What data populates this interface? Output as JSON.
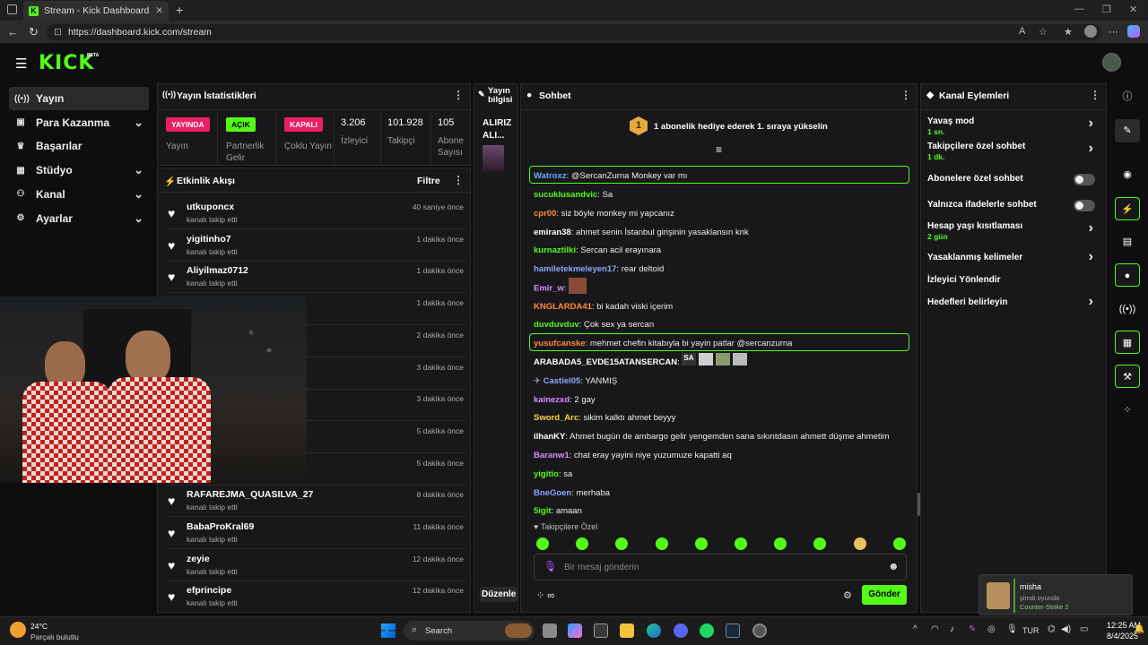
{
  "browser": {
    "tab_title": "Stream - Kick Dashboard",
    "url": "https://dashboard.kick.com/stream",
    "new_tab": "+",
    "close_tab": "✕"
  },
  "header": {
    "logo": "KICK",
    "beta": "BETA"
  },
  "sidebar": {
    "items": [
      {
        "label": "Yayın",
        "icon": "broadcast-icon",
        "expandable": false
      },
      {
        "label": "Para Kazanma",
        "icon": "money-icon",
        "expandable": true
      },
      {
        "label": "Başarılar",
        "icon": "trophy-icon",
        "expandable": false
      },
      {
        "label": "Stüdyo",
        "icon": "studio-icon",
        "expandable": true
      },
      {
        "label": "Kanal",
        "icon": "channel-icon",
        "expandable": true
      },
      {
        "label": "Ayarlar",
        "icon": "gear-icon",
        "expandable": true
      }
    ]
  },
  "stats": {
    "title": "Yayın İstatistikleri",
    "cols": [
      {
        "badge": "YAYINDA",
        "label": "Yayın",
        "color": "#e91e63"
      },
      {
        "badge": "AÇIK",
        "label": "Partnerlik Gelir",
        "color": "#53fc18"
      },
      {
        "badge": "KAPALI",
        "label": "Çoklu Yayın",
        "color": "#e91e63"
      },
      {
        "value": "3.206",
        "label": "İzleyici"
      },
      {
        "value": "101.928",
        "label": "Takipçi"
      },
      {
        "value": "105",
        "label": "Abone Sayısı"
      }
    ]
  },
  "activity": {
    "title": "Etkinlik Akışı",
    "filter": "Filtre",
    "events": [
      {
        "name": "utkuponcx",
        "sub": "kanalı takip etti",
        "time": "40 saniye önce"
      },
      {
        "name": "yigitinho7",
        "sub": "kanalı takip etti",
        "time": "1 dakika önce"
      },
      {
        "name": "Aliyilmaz0712",
        "sub": "kanalı takip etti",
        "time": "1 dakika önce"
      },
      {
        "name": "",
        "sub": "",
        "time": "1 dakika önce"
      },
      {
        "name": "",
        "sub": "",
        "time": "2 dakika önce"
      },
      {
        "name": "",
        "sub": "",
        "time": "3 dakika önce"
      },
      {
        "name": "",
        "sub": "",
        "time": "3 dakika önce"
      },
      {
        "name": "",
        "sub": "",
        "time": "5 dakika önce"
      },
      {
        "name": "",
        "sub": "",
        "time": "5 dakika önce"
      },
      {
        "name": "RAFAREJMA_QUASILVA_27",
        "sub": "kanalı takip etti",
        "time": "8 dakika önce"
      },
      {
        "name": "BabaProKral69",
        "sub": "kanalı takip etti",
        "time": "11 dakika önce"
      },
      {
        "name": "zeyie",
        "sub": "kanalı takip etti",
        "time": "12 dakika önce"
      },
      {
        "name": "efprincipe",
        "sub": "kanalı takip etti",
        "time": "12 dakika önce"
      }
    ]
  },
  "yayin_bilgisi": {
    "title": "Yayın bilgisi",
    "name": "ALIRIZ ALI...",
    "edit": "Düzenle"
  },
  "chat": {
    "title": "Sohbet",
    "promo_rank": "1",
    "promo": "1 abonelik hediye ederek 1. sıraya yükselin",
    "messages": [
      {
        "user": "Watroxz",
        "color": "#6aa9ff",
        "text": "@SercanZurna Monkey var mı",
        "highlight": true
      },
      {
        "user": "sucuklusandvic",
        "color": "#53fc18",
        "text": "Sa"
      },
      {
        "user": "cpr00",
        "color": "#ff8a3c",
        "text": "siz böyle monkey mi yapcanız"
      },
      {
        "user": "emiran38",
        "color": "#ffffff",
        "text": "ahmet senin İstanbul girişinin yasaklansın knk"
      },
      {
        "user": "kurnaztilki",
        "color": "#53fc18",
        "text": "Sercan acil erayınara"
      },
      {
        "user": "hamiletekmeleyen17",
        "color": "#8fa8ff",
        "text": "rear deltoid"
      },
      {
        "user": "Emir_w",
        "color": "#d890ff",
        "text": ""
      },
      {
        "user": "KNGLARDA41",
        "color": "#ff8a3c",
        "text": "bi kadah viski içerim"
      },
      {
        "user": "duvduvduv",
        "color": "#53fc18",
        "text": "Çok sex ya sercan"
      },
      {
        "user": "yusufcanske",
        "color": "#ff8a3c",
        "text": "mehmet chefin kitabıyla bi yayin patlar @sercanzurna",
        "highlight": true
      },
      {
        "user": "ARABADA5_EVDE15ATANSERCAN",
        "color": "#ffffff",
        "text": ""
      },
      {
        "user": "Castiel05",
        "color": "#8fa8ff",
        "text": "YANMIŞ"
      },
      {
        "user": "kainezxd",
        "color": "#d890ff",
        "text": "2 gay"
      },
      {
        "user": "Sword_Arc",
        "color": "#ffd23c",
        "text": "sikim kalktı ahmet beyyy"
      },
      {
        "user": "ilhanKY",
        "color": "#ffffff",
        "text": "Ahmet bugün de ambargo gelir yengemden sana sıkıntdasın ahmett düşme ahmetim"
      },
      {
        "user": "Baranw1",
        "color": "#d890ff",
        "text": "chat eray yayini niye yuzumuze kapatti aq"
      },
      {
        "user": "yigitio",
        "color": "#53fc18",
        "text": "sa"
      },
      {
        "user": "BneGoen",
        "color": "#8fa8ff",
        "text": "merhaba"
      },
      {
        "user": "5igit",
        "color": "#53fc18",
        "text": "amaan"
      }
    ],
    "followers_only": "Takipçilere Özel",
    "placeholder": "Bir mesaj gönderin",
    "send": "Gönder",
    "sa_label": "SA"
  },
  "channel": {
    "title": "Kanal Eylemleri",
    "rows": [
      {
        "label": "Yavaş mod",
        "sub": "1 sn.",
        "kind": "chevron"
      },
      {
        "label": "Takipçilere özel sohbet",
        "sub": "1 dk.",
        "kind": "chevron"
      },
      {
        "label": "Abonelere özel sohbet",
        "sub": "",
        "kind": "toggle"
      },
      {
        "label": "Yalnızca ifadelerle sohbet",
        "sub": "",
        "kind": "toggle"
      },
      {
        "label": "Hesap yaşı kısıtlaması",
        "sub": "2 gün",
        "kind": "chevron"
      },
      {
        "label": "Yasaklanmış kelimeler",
        "sub": "",
        "kind": "chevron"
      },
      {
        "label": "İzleyici Yönlendir",
        "sub": "",
        "kind": "none"
      },
      {
        "label": "Hedefleri belirleyin",
        "sub": "",
        "kind": "chevron"
      }
    ]
  },
  "toast": {
    "name": "misha",
    "status": "şimdi oyunda",
    "game": "Counter-Strike 2"
  },
  "taskbar": {
    "weather_temp": "24°C",
    "weather_desc": "Parçalı bulutlu",
    "search": "Search",
    "lang": "TUR",
    "time": "12:25 AM",
    "date": "8/4/2025"
  },
  "accent": "#53fc18"
}
